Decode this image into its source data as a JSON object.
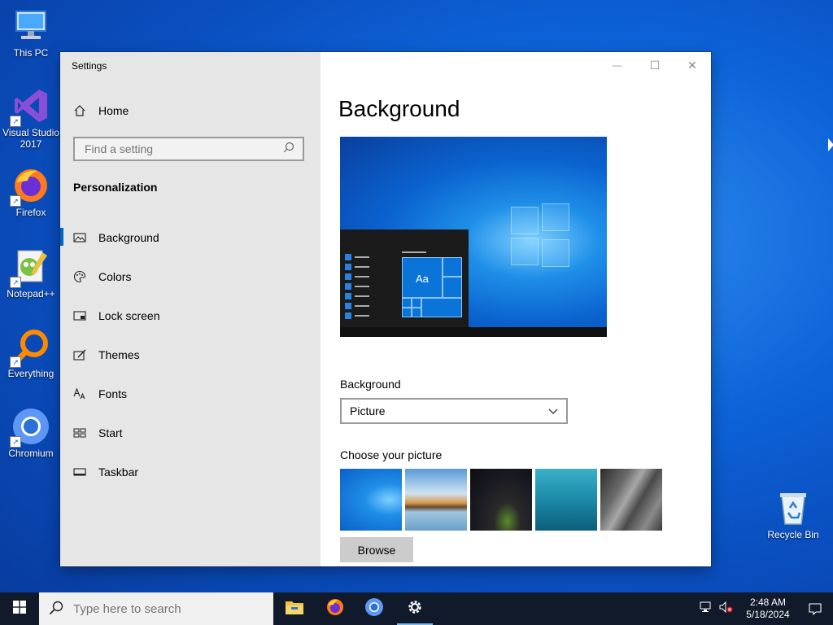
{
  "desktop": {
    "icons": [
      {
        "label": "This PC",
        "icon": "computer-icon"
      },
      {
        "label": "Visual Studio\n2017",
        "icon": "visual-studio-icon"
      },
      {
        "label": "Firefox",
        "icon": "firefox-icon"
      },
      {
        "label": "Notepad++",
        "icon": "notepad-plus-plus-icon"
      },
      {
        "label": "Everything",
        "icon": "everything-search-icon"
      },
      {
        "label": "Chromium",
        "icon": "chromium-icon"
      },
      {
        "label": "Recycle Bin",
        "icon": "recycle-bin-icon"
      }
    ]
  },
  "window": {
    "title": "Settings",
    "controls": {
      "minimize": "—",
      "maximize": "☐",
      "close": "✕"
    }
  },
  "sidebar": {
    "home_label": "Home",
    "search_placeholder": "Find a setting",
    "section_title": "Personalization",
    "items": [
      {
        "label": "Background",
        "icon": "picture-icon",
        "active": true
      },
      {
        "label": "Colors",
        "icon": "palette-icon",
        "active": false
      },
      {
        "label": "Lock screen",
        "icon": "lock-screen-icon",
        "active": false
      },
      {
        "label": "Themes",
        "icon": "themes-brush-icon",
        "active": false
      },
      {
        "label": "Fonts",
        "icon": "fonts-icon",
        "active": false
      },
      {
        "label": "Start",
        "icon": "start-tiles-icon",
        "active": false
      },
      {
        "label": "Taskbar",
        "icon": "taskbar-icon",
        "active": false
      }
    ]
  },
  "main": {
    "title": "Background",
    "preview_tile_text": "Aa",
    "background_label": "Background",
    "background_value": "Picture",
    "choose_label": "Choose your picture",
    "browse_label": "Browse"
  },
  "taskbar": {
    "search_placeholder": "Type here to search",
    "apps": [
      "file-explorer-icon",
      "firefox-icon",
      "chromium-icon",
      "settings-gear-icon"
    ],
    "clock_time": "2:48 AM",
    "clock_date": "5/18/2024"
  },
  "colors": {
    "accent": "#0067c0",
    "sidebar_bg": "#e6e6e6",
    "taskbar_bg": "#101a2a"
  }
}
